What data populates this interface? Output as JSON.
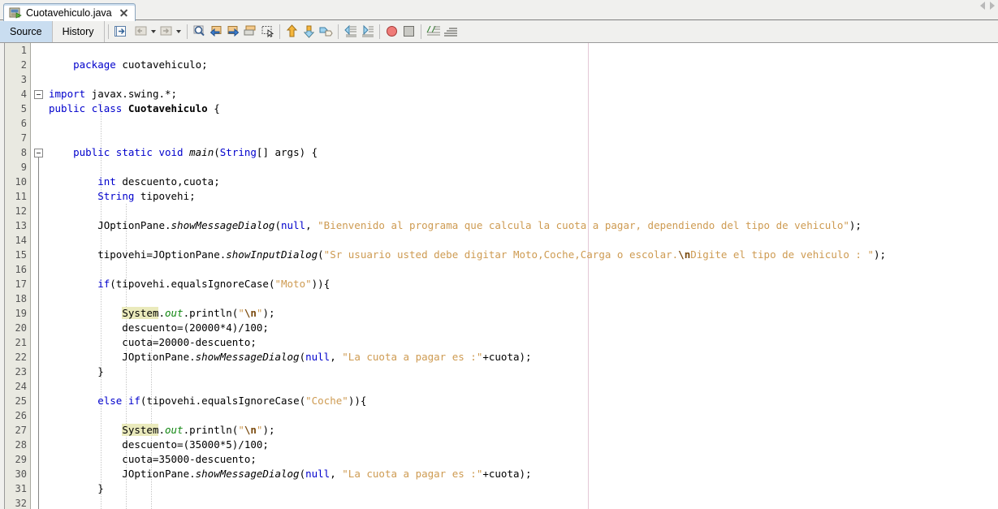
{
  "window": {
    "tab": {
      "label": "Cuotavehiculo.java",
      "icon": "java-file-icon",
      "close_icon": "close-icon"
    },
    "tab_scroll": {
      "left_icon": "scroll-left-icon",
      "right_icon": "scroll-right-icon"
    }
  },
  "view_tabs": [
    {
      "label": "Source",
      "selected": true
    },
    {
      "label": "History",
      "selected": false
    }
  ],
  "toolbar": {
    "groups": [
      {
        "items": [
          {
            "name": "toggle-bookmark-icon",
            "title": "Toggle Bookmark"
          }
        ]
      },
      {
        "items": [
          {
            "name": "previous-bookmark-icon",
            "title": "Previous Bookmark",
            "dropdown": true
          },
          {
            "name": "next-bookmark-icon",
            "title": "Next Bookmark",
            "dropdown": true
          }
        ]
      },
      {
        "items": [
          {
            "name": "find-selection-icon",
            "title": "Find Selection"
          },
          {
            "name": "find-previous-icon",
            "title": "Find Previous Occurrence"
          },
          {
            "name": "find-next-icon",
            "title": "Find Next Occurrence"
          },
          {
            "name": "toggle-highlight-search-icon",
            "title": "Toggle Highlight Search"
          },
          {
            "name": "toggle-rectangular-selection-icon",
            "title": "Toggle Rectangular Selection"
          }
        ]
      },
      {
        "items": [
          {
            "name": "previous-error-icon",
            "title": "Previous Error"
          },
          {
            "name": "next-error-icon",
            "title": "Next Error"
          },
          {
            "name": "last-edit-icon",
            "title": "Last Edit Position"
          }
        ]
      },
      {
        "items": [
          {
            "name": "shift-left-icon",
            "title": "Shift Line Left"
          },
          {
            "name": "shift-right-icon",
            "title": "Shift Line Right"
          }
        ]
      },
      {
        "items": [
          {
            "name": "start-macro-recording-icon",
            "title": "Start Macro Recording"
          },
          {
            "name": "stop-macro-recording-icon",
            "title": "Stop Macro Recording"
          }
        ]
      },
      {
        "items": [
          {
            "name": "comment-icon",
            "title": "Comment"
          },
          {
            "name": "uncomment-icon",
            "title": "Uncomment"
          }
        ]
      }
    ]
  },
  "editor": {
    "first_line": 1,
    "last_line": 32,
    "line_numbers": [
      1,
      2,
      3,
      4,
      5,
      6,
      7,
      8,
      9,
      10,
      11,
      12,
      13,
      14,
      15,
      16,
      17,
      18,
      19,
      20,
      21,
      22,
      23,
      24,
      25,
      26,
      27,
      28,
      29,
      30,
      31,
      32
    ],
    "fold_markers": [
      {
        "line": 4,
        "state": "expanded"
      },
      {
        "line": 8,
        "state": "expanded"
      }
    ],
    "margin_column_marker": true,
    "lines": [
      "",
      "    package cuotavehiculo;",
      "",
      "import javax.swing.*;",
      "public class Cuotavehiculo {",
      "",
      "",
      "    public static void main(String[] args) {",
      "",
      "        int descuento,cuota;",
      "        String tipovehi;",
      "",
      "        JOptionPane.showMessageDialog(null, \"Bienvenido al programa que calcula la cuota a pagar, dependiendo del tipo de vehiculo\");",
      "",
      "        tipovehi=JOptionPane.showInputDialog(\"Sr usuario usted debe digitar Moto,Coche,Carga o escolar.\\nDigite el tipo de vehiculo : \");",
      "",
      "        if(tipovehi.equalsIgnoreCase(\"Moto\")){",
      "",
      "            System.out.println(\"\\n\");",
      "            descuento=(20000*4)/100;",
      "            cuota=20000-descuento;",
      "            JOptionPane.showMessageDialog(null, \"La cuota a pagar es :\"+cuota);",
      "        }",
      "",
      "        else if(tipovehi.equalsIgnoreCase(\"Coche\")){",
      "",
      "            System.out.println(\"\\n\");",
      "            descuento=(35000*5)/100;",
      "            cuota=35000-descuento;",
      "            JOptionPane.showMessageDialog(null, \"La cuota a pagar es :\"+cuota);",
      "        }",
      ""
    ]
  },
  "colors": {
    "keyword": "#0000cc",
    "string": "#ce9b52",
    "escape": "#7a4b10",
    "field": "#128712",
    "gutter_bg": "#e9e9e1",
    "selected_tab_bg": "#c9ddf0",
    "highlight_bg": "#eaeabc",
    "margin_line": "#e3c8d6"
  }
}
